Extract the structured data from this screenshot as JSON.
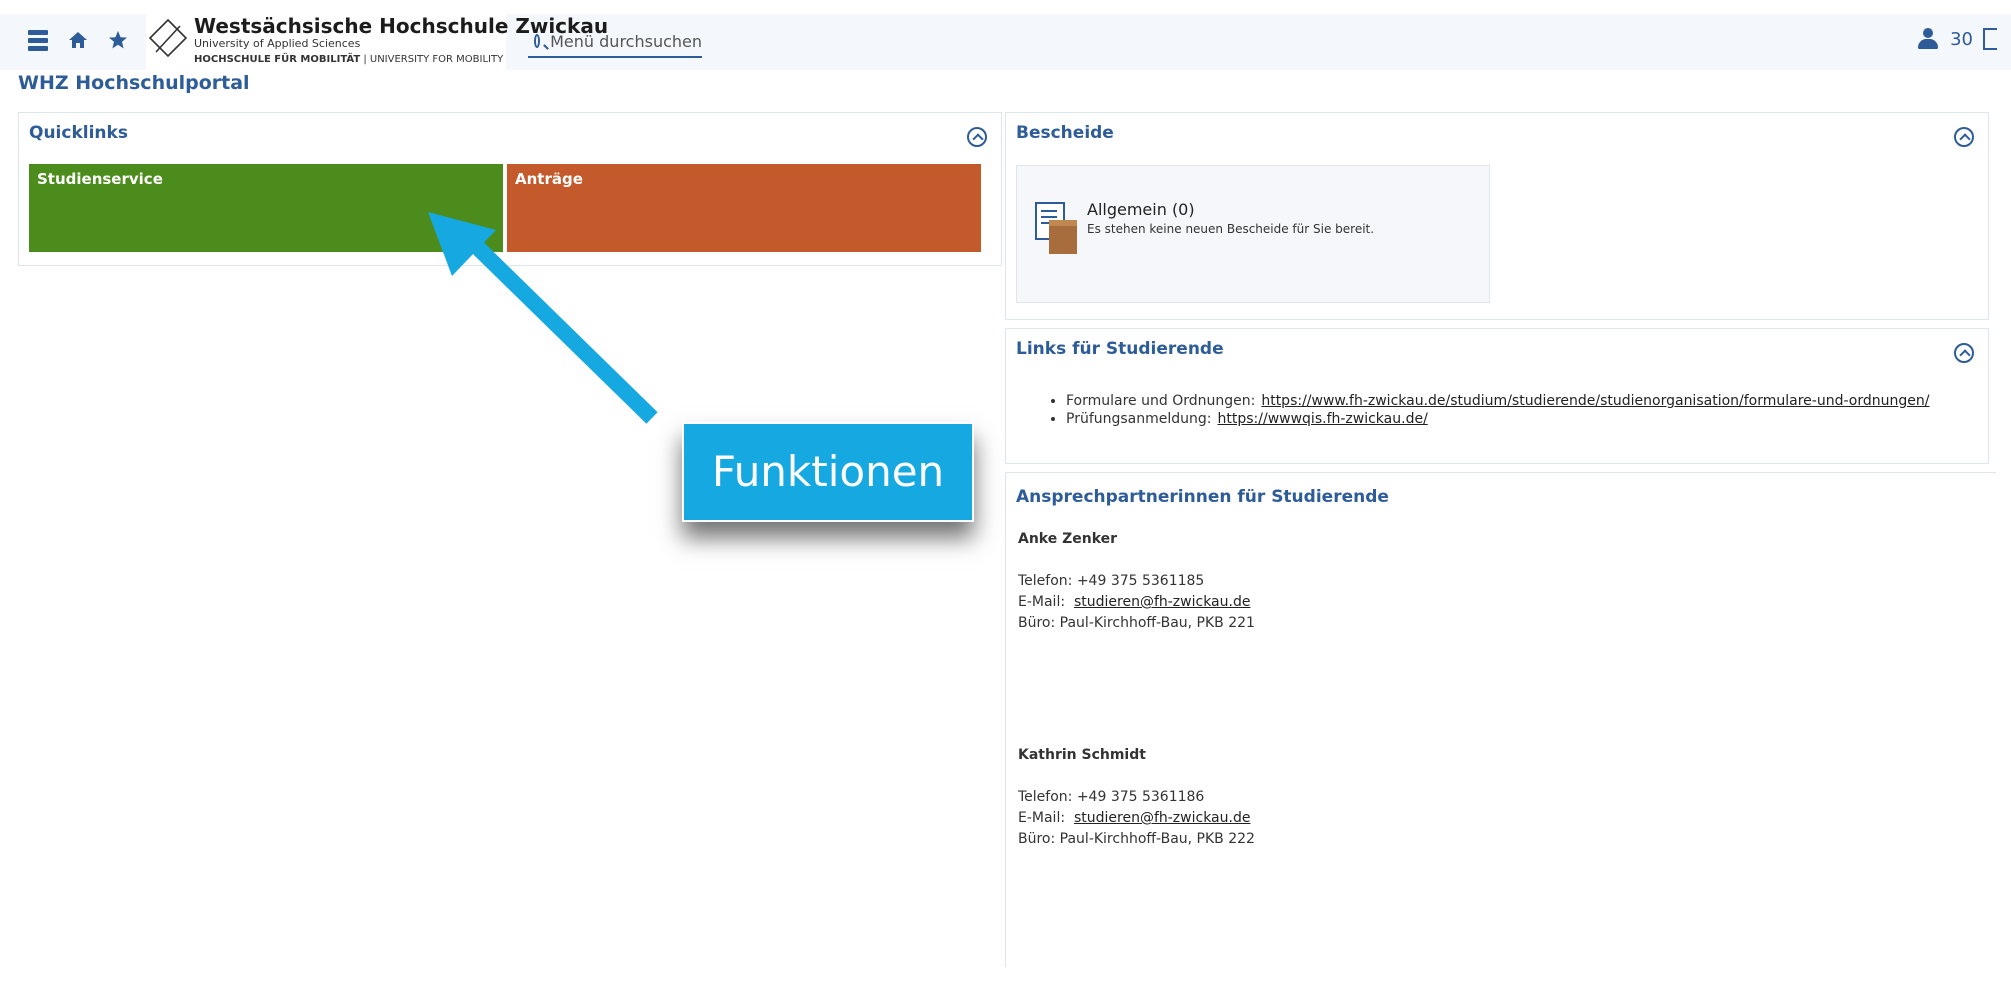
{
  "header": {
    "logo": {
      "name": "Westsächsische Hochschule Zwickau",
      "subtitle": "University of Applied Sciences",
      "tagline_bold": "HOCHSCHULE FÜR MOBILITÄT",
      "tagline_rest": " | UNIVERSITY FOR MOBILITY"
    },
    "search_placeholder": "Menü durchsuchen",
    "user_count": "30"
  },
  "page_title": "WHZ Hochschulportal",
  "quicklinks": {
    "title": "Quicklinks",
    "tiles": [
      {
        "label": "Studienservice",
        "color": "#4c8c1c"
      },
      {
        "label": "Anträge",
        "color": "#c45a2b"
      }
    ]
  },
  "bescheide": {
    "title": "Bescheide",
    "item_title": "Allgemein (0)",
    "item_text": "Es stehen keine neuen Bescheide für Sie bereit."
  },
  "links": {
    "title": "Links für Studierende",
    "items": [
      {
        "label": "Formulare und Ordnungen:",
        "url": "https://www.fh-zwickau.de/studium/studierende/studienorganisation/formulare-und-ordnungen/"
      },
      {
        "label": "Prüfungsanmeldung:",
        "url": "https://wwwqis.fh-zwickau.de/"
      }
    ]
  },
  "contacts": {
    "title": "Ansprechpartnerinnen für Studierende",
    "people": [
      {
        "name": "Anke Zenker",
        "phone": "Telefon: +49 375 5361185",
        "email_label": "E-Mail:",
        "email": "studieren@fh-zwickau.de",
        "office": "Büro: Paul-Kirchhoff-Bau, PKB 221"
      },
      {
        "name": "Kathrin Schmidt",
        "phone": "Telefon: +49 375 5361186",
        "email_label": "E-Mail:",
        "email": "studieren@fh-zwickau.de",
        "office": "Büro: Paul-Kirchhoff-Bau, PKB 222"
      }
    ]
  },
  "annotation": {
    "label": "Funktionen",
    "color": "#16a8e1"
  },
  "colors": {
    "accent": "#2d5c99"
  }
}
